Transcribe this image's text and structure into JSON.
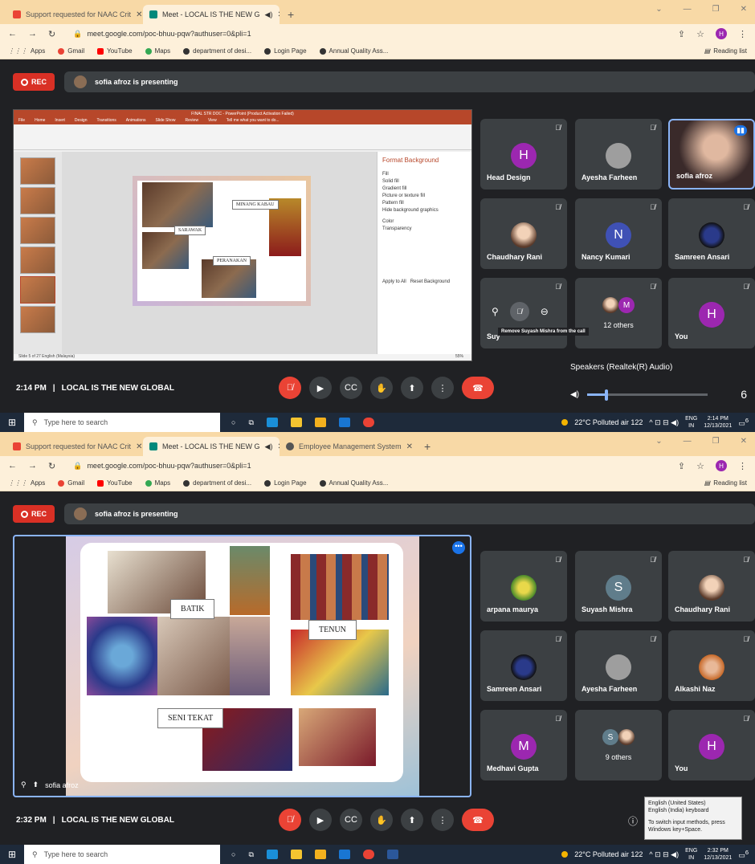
{
  "s1": {
    "tabs": [
      {
        "title": "Support requested for NAAC Crit"
      },
      {
        "title": "Meet - LOCAL IS THE NEW G"
      }
    ],
    "url": "meet.google.com/poc-bhuu-pqw?authuser=0&pli=1",
    "profile_initial": "H",
    "bookmarks": [
      "Apps",
      "Gmail",
      "YouTube",
      "Maps",
      "department of desi...",
      "Login Page",
      "Annual Quality Ass...",
      "Reading list"
    ],
    "rec_label": "REC",
    "presenting": "sofia afroz is presenting",
    "ppt": {
      "title": "FINAL STR DOC - PowerPoint (Product Activation Failed)",
      "menu": [
        "File",
        "Home",
        "Insert",
        "Design",
        "Transitions",
        "Animations",
        "Slide Show",
        "Review",
        "View",
        "Tell me what you want to do..."
      ],
      "labels": {
        "minang": "MINANG KABAU",
        "sarawak": "SARAWAK",
        "peranakan": "PERANAKAN"
      },
      "panel_title": "Format Background",
      "panel_options": [
        "Fill",
        "Solid fill",
        "Gradient fill",
        "Picture or texture fill",
        "Pattern fill",
        "Hide background graphics",
        "Color",
        "Transparency",
        "Apply to All",
        "Reset Background"
      ],
      "status": "Slide 5 of 27    English (Malaysia)",
      "zoom": "55%"
    },
    "tiles": [
      {
        "name": "Head Design",
        "initial": "H",
        "color": "#9c27b0"
      },
      {
        "name": "Ayesha Farheen",
        "initial": "",
        "color": "#9e9e9e"
      },
      {
        "name": "sofia afroz",
        "initial": "",
        "color": ""
      },
      {
        "name": "Chaudhary Rani",
        "initial": "",
        "color": ""
      },
      {
        "name": "Nancy Kumari",
        "initial": "N",
        "color": "#3f51b5"
      },
      {
        "name": "Samreen Ansari",
        "initial": "",
        "color": ""
      },
      {
        "name": "Suy",
        "initial": "",
        "color": ""
      },
      {
        "name": "12 others",
        "initial": "M",
        "color": "#9c27b0"
      },
      {
        "name": "You",
        "initial": "H",
        "color": "#9c27b0"
      }
    ],
    "tooltip": "Remove Suyash Mishra from the call",
    "time": "2:14 PM",
    "meeting": "LOCAL IS THE NEW GLOBAL",
    "speakers": "Speakers (Realtek(R) Audio)",
    "volume": "6",
    "volume_level": 0.16,
    "taskbar": {
      "search": "Type here to search",
      "weather": "22°C  Polluted air 122",
      "lang": "ENG",
      "region": "IN",
      "clock_time": "2:14 PM",
      "clock_date": "12/13/2021",
      "notif": "6"
    }
  },
  "s2": {
    "tabs": [
      {
        "title": "Support requested for NAAC Crit"
      },
      {
        "title": "Meet - LOCAL IS THE NEW G"
      },
      {
        "title": "Employee Management System"
      }
    ],
    "url": "meet.google.com/poc-bhuu-pqw?authuser=0&pli=1",
    "profile_initial": "H",
    "bookmarks": [
      "Apps",
      "Gmail",
      "YouTube",
      "Maps",
      "department of desi...",
      "Login Page",
      "Annual Quality Ass...",
      "Reading list"
    ],
    "rec_label": "REC",
    "presenting": "sofia afroz is presenting",
    "slide_labels": {
      "batik": "BATIK",
      "tenun": "TENUN",
      "seni": "SENI TEKAT"
    },
    "presenter_name": "sofia afroz",
    "tiles": [
      {
        "name": "arpana maurya",
        "initial": "",
        "color": ""
      },
      {
        "name": "Suyash Mishra",
        "initial": "S",
        "color": "#607d8b"
      },
      {
        "name": "Chaudhary Rani",
        "initial": "",
        "color": ""
      },
      {
        "name": "Samreen Ansari",
        "initial": "",
        "color": ""
      },
      {
        "name": "Ayesha Farheen",
        "initial": "",
        "color": "#9e9e9e"
      },
      {
        "name": "Alkashi Naz",
        "initial": "",
        "color": ""
      },
      {
        "name": "Medhavi Gupta",
        "initial": "M",
        "color": "#9c27b0"
      },
      {
        "name": "9 others",
        "initial": "S",
        "color": "#607d8b"
      },
      {
        "name": "You",
        "initial": "H",
        "color": "#9c27b0"
      }
    ],
    "time": "2:32 PM",
    "meeting": "LOCAL IS THE NEW GLOBAL",
    "ime": {
      "line1": "English (United States)",
      "line2": "English (India) keyboard",
      "line3": "To switch input methods, press Windows key+Space."
    },
    "taskbar": {
      "search": "Type here to search",
      "weather": "22°C  Polluted air 122",
      "lang": "ENG",
      "region": "IN",
      "clock_time": "2:32 PM",
      "clock_date": "12/13/2021",
      "notif": "6"
    }
  }
}
